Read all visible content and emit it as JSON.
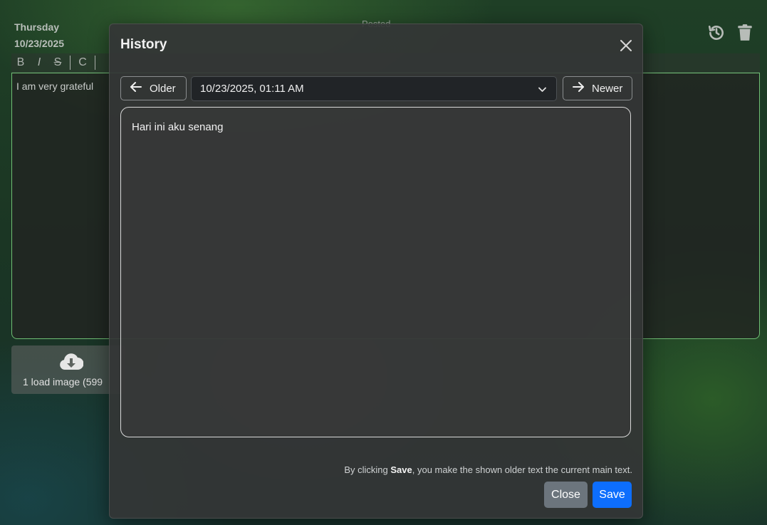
{
  "entry": {
    "day": "Thursday",
    "date": "10/23/2025",
    "posted_label": "Posted",
    "text": "I am very grateful",
    "toolbar": {
      "bold": "B",
      "italic": "I",
      "strike": "S",
      "code": "C"
    },
    "upload_label": "1 load image (599"
  },
  "modal": {
    "title": "History",
    "older_label": "Older",
    "newer_label": "Newer",
    "selected_version": "10/23/2025, 01:11 AM",
    "content": "Hari ini aku senang",
    "footnote_prefix": "By clicking ",
    "footnote_bold": "Save",
    "footnote_suffix": ", you make the shown older text the current main text.",
    "close_label": "Close",
    "save_label": "Save"
  },
  "colors": {
    "primary": "#0d6efd",
    "secondary": "#6c757d",
    "editor_border": "#6fbe74"
  },
  "icons": [
    "history-icon",
    "trash-icon",
    "cloud-download-icon",
    "arrow-left-icon",
    "arrow-right-icon",
    "chevron-down-icon",
    "close-icon"
  ]
}
